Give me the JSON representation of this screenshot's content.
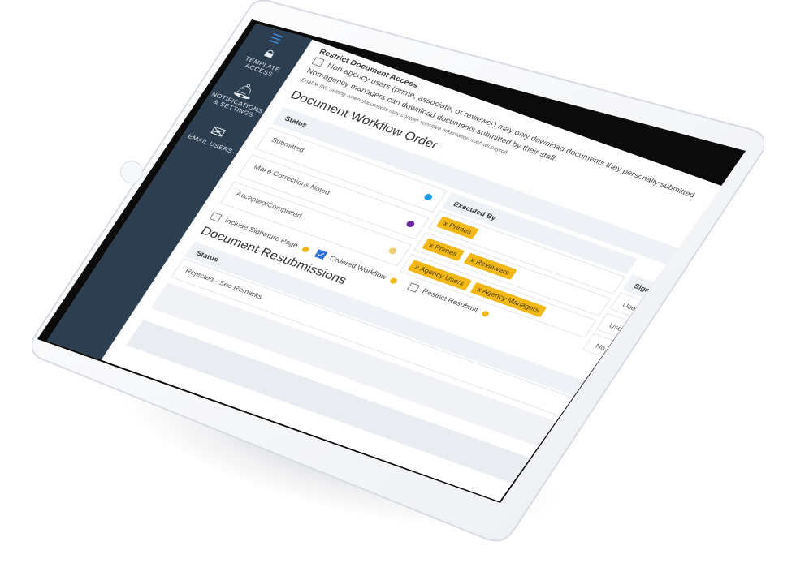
{
  "sidebar": {
    "items": [
      {
        "label": "TEMPLATE ACCESS",
        "icon": "lock-icon"
      },
      {
        "label": "NOTIFICATIONS & SETTINGS",
        "icon": "bell-icon"
      },
      {
        "label": "EMAIL USERS",
        "icon": "envelope-icon"
      }
    ]
  },
  "restrict": {
    "title": "Restrict Document Access",
    "option_label": "Non-agency users (prime, associate, or reviewer) may only download documents they personally submitted.",
    "managers_note": "Non-agency managers can download documents submitted by their staff.",
    "hint": "Enable this setting when documents may contain sensitive information such as payroll"
  },
  "workflow": {
    "title": "Document Workflow Order",
    "headers": {
      "status": "Status",
      "executed_by": "Executed By",
      "signature": "Signature"
    },
    "rows": [
      {
        "status": "Submitted",
        "dot_color": "#1f9be6",
        "executed_by": [
          "x Primes"
        ],
        "signature": "User types"
      },
      {
        "status": "Make Corrections Noted",
        "dot_color": "#6a2a9e",
        "executed_by": [
          "x Primes",
          "x Reviewers"
        ],
        "signature": "User select"
      },
      {
        "status": "Accepted/Completed",
        "dot_color": "#f0cf73",
        "executed_by": [
          "x Agency Users",
          "x Agency Managers"
        ],
        "signature": "No signatu"
      }
    ],
    "options": [
      {
        "label": "Include Signature Page",
        "checked": false
      },
      {
        "label": "Ordered Workflow",
        "checked": true
      },
      {
        "label": "Restrict Resubmit",
        "checked": false
      }
    ]
  },
  "resubmissions": {
    "title": "Document Resubmissions",
    "header": "Status",
    "rows": [
      "Rejected - See Remarks"
    ]
  },
  "colors": {
    "sidebar": "#2d3e50",
    "accent": "#3f8fd8",
    "tag": "#f2b818"
  }
}
